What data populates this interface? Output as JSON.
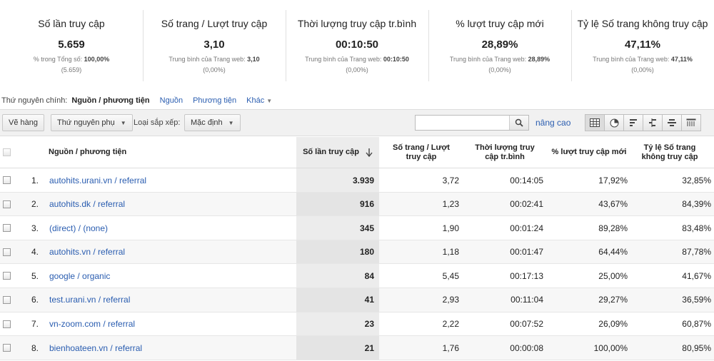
{
  "summary": [
    {
      "title": "Số lần truy cập",
      "value": "5.659",
      "sub_label": "% trong Tổng số:",
      "sub_value": "100,00%",
      "sub2": "(5.659)"
    },
    {
      "title": "Số trang / Lượt truy cập",
      "value": "3,10",
      "sub_label": "Trung bình của Trang web:",
      "sub_value": "3,10",
      "sub2": "(0,00%)"
    },
    {
      "title": "Thời lượng truy cập tr.bình",
      "value": "00:10:50",
      "sub_label": "Trung bình của Trang web:",
      "sub_value": "00:10:50",
      "sub2": "(0,00%)"
    },
    {
      "title": "% lượt truy cập mới",
      "value": "28,89%",
      "sub_label": "Trung bình của Trang web:",
      "sub_value": "28,89%",
      "sub2": "(0,00%)"
    },
    {
      "title": "Tỷ lệ Số trang không truy cập",
      "value": "47,11%",
      "sub_label": "Trung bình của Trang web:",
      "sub_value": "47,11%",
      "sub2": "(0,00%)"
    }
  ],
  "dimension": {
    "label": "Thứ nguyên chính:",
    "current": "Nguồn / phương tiện",
    "links": [
      "Nguồn",
      "Phương tiện",
      "Khác"
    ]
  },
  "toolbar": {
    "plot_rows": "Vẽ hàng",
    "secondary_dim": "Thứ nguyên phụ",
    "sort_label": "Loại sắp xếp:",
    "sort_value": "Mặc định",
    "search_value": "",
    "advanced": "nâng cao"
  },
  "headers": {
    "dimension": "Nguồn / phương tiện",
    "visits": "Số lần truy cập",
    "pages_per_visit": "Số trang / Lượt truy cập",
    "avg_duration": "Thời lượng truy cập tr.bình",
    "new_visits": "% lượt truy cập mới",
    "bounce": "Tỷ lệ Số trang không truy cập"
  },
  "rows": [
    {
      "idx": "1.",
      "source": "autohits.urani.vn / referral",
      "visits": "3.939",
      "ppv": "3,72",
      "dur": "00:14:05",
      "new": "17,92%",
      "bounce": "32,85%"
    },
    {
      "idx": "2.",
      "source": "autohits.dk / referral",
      "visits": "916",
      "ppv": "1,23",
      "dur": "00:02:41",
      "new": "43,67%",
      "bounce": "84,39%"
    },
    {
      "idx": "3.",
      "source": "(direct) / (none)",
      "visits": "345",
      "ppv": "1,90",
      "dur": "00:01:24",
      "new": "89,28%",
      "bounce": "83,48%"
    },
    {
      "idx": "4.",
      "source": "autohits.vn / referral",
      "visits": "180",
      "ppv": "1,18",
      "dur": "00:01:47",
      "new": "64,44%",
      "bounce": "87,78%"
    },
    {
      "idx": "5.",
      "source": "google / organic",
      "visits": "84",
      "ppv": "5,45",
      "dur": "00:17:13",
      "new": "25,00%",
      "bounce": "41,67%"
    },
    {
      "idx": "6.",
      "source": "test.urani.vn / referral",
      "visits": "41",
      "ppv": "2,93",
      "dur": "00:11:04",
      "new": "29,27%",
      "bounce": "36,59%"
    },
    {
      "idx": "7.",
      "source": "vn-zoom.com / referral",
      "visits": "23",
      "ppv": "2,22",
      "dur": "00:07:52",
      "new": "26,09%",
      "bounce": "60,87%"
    },
    {
      "idx": "8.",
      "source": "bienhoateen.vn / referral",
      "visits": "21",
      "ppv": "1,76",
      "dur": "00:00:08",
      "new": "100,00%",
      "bounce": "80,95%"
    }
  ]
}
